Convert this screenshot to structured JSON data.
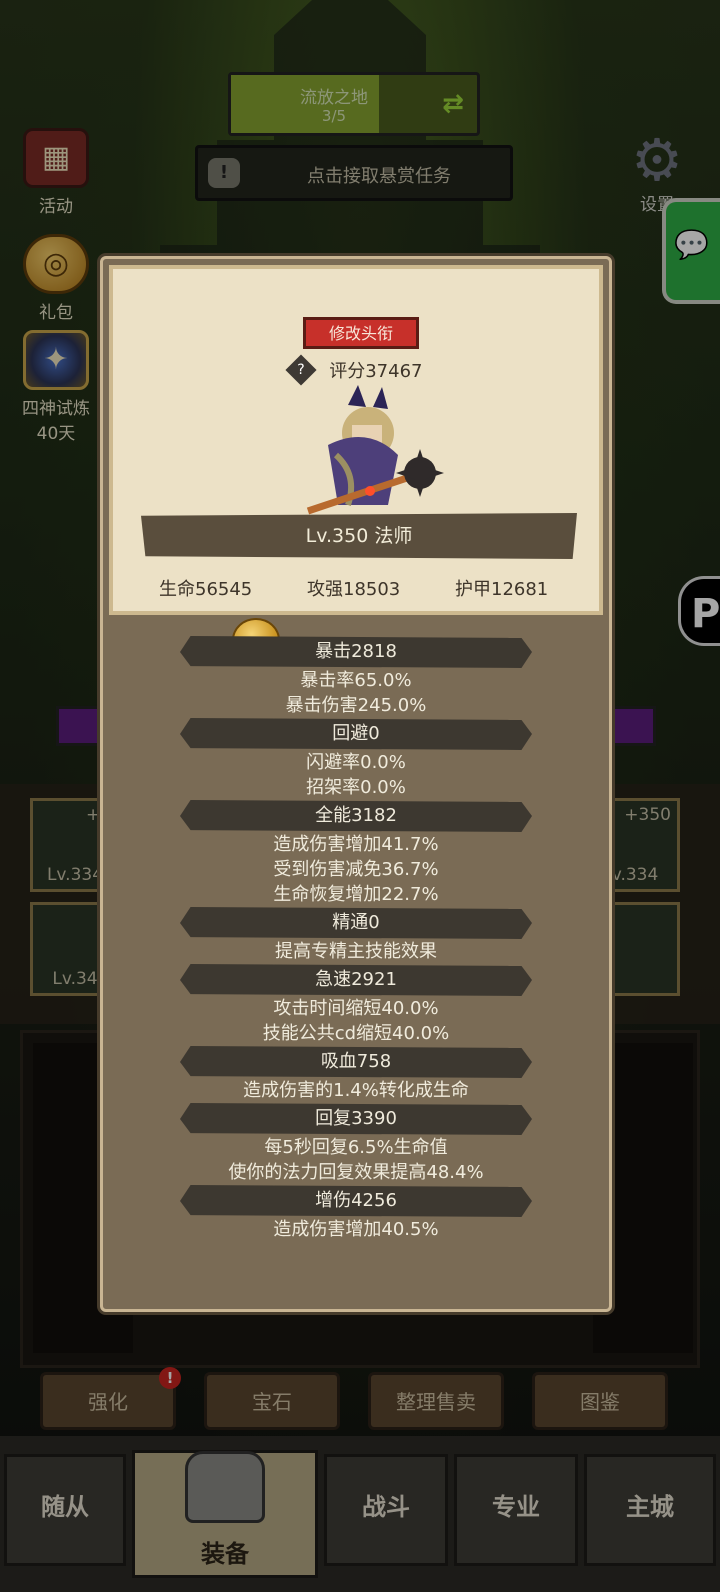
{
  "zone": {
    "name": "流放之地",
    "progress": "3/5",
    "progress_fraction": 0.6
  },
  "bounty": {
    "text": "点击接取悬赏任务"
  },
  "side_icons": [
    {
      "label": "活动",
      "icon": "activity-book-icon"
    },
    {
      "label": "礼包",
      "icon": "gift-coin-icon"
    },
    {
      "label_line1": "四神试炼",
      "label_line2": "40天",
      "icon": "four-gods-trial-icon"
    }
  ],
  "settings": {
    "label": "设置",
    "icon": "gear-icon"
  },
  "hero": {
    "title_button": "修改头衔",
    "score": "评分37467",
    "level_class": "Lv.350 法师",
    "hp": "生命56545",
    "attack": "攻强18503",
    "armor": "护甲12681"
  },
  "stats": [
    {
      "title": "暴击2818",
      "lines": [
        "暴击率65.0%",
        "暴击伤害245.0%"
      ]
    },
    {
      "title": "回避0",
      "lines": [
        "闪避率0.0%",
        "招架率0.0%"
      ]
    },
    {
      "title": "全能3182",
      "lines": [
        "造成伤害增加41.7%",
        "受到伤害减免36.7%",
        "生命恢复增加22.7%"
      ]
    },
    {
      "title": "精通0",
      "lines": [
        "提高专精主技能效果"
      ]
    },
    {
      "title": "急速2921",
      "lines": [
        "攻击时间缩短40.0%",
        "技能公共cd缩短40.0%"
      ]
    },
    {
      "title": "吸血758",
      "lines": [
        "造成伤害的1.4%转化成生命"
      ]
    },
    {
      "title": "回复3390",
      "lines": [
        "每5秒回复6.5%生命值",
        "使你的法力回复效果提高48.4%"
      ]
    },
    {
      "title": "增伤4256",
      "lines": [
        "造成伤害增加40.5%"
      ]
    }
  ],
  "equipment": {
    "left_top": {
      "plus": "+3",
      "level": "Lv.334"
    },
    "left_bottom": {
      "level": "Lv.34"
    },
    "right_top": {
      "plus": "+350",
      "level": "v.334"
    }
  },
  "actions": [
    "强化",
    "宝石",
    "整理售卖",
    "图鉴"
  ],
  "nav": [
    "随从",
    "装备",
    "战斗",
    "专业",
    "主城"
  ]
}
